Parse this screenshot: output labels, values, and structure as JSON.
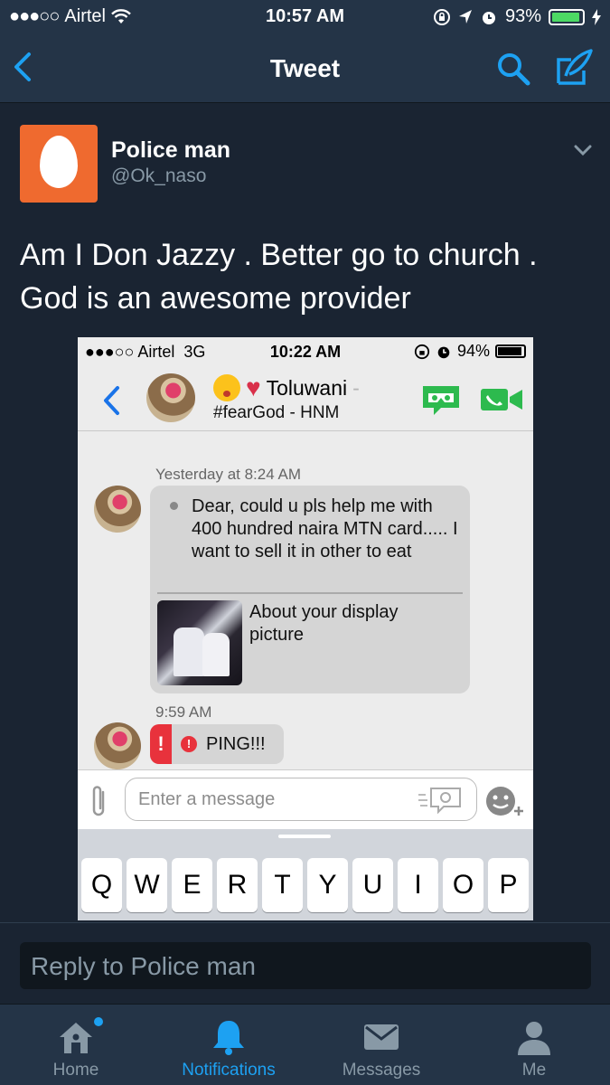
{
  "status_bar": {
    "signal": "●●●○○",
    "carrier": "Airtel",
    "time": "10:57 AM",
    "battery": "93%"
  },
  "nav": {
    "title": "Tweet"
  },
  "tweet": {
    "name": "Police man",
    "handle": "@Ok_naso",
    "text": "Am I Don Jazzy . Better go to church . God is an awesome provider"
  },
  "embedded_screenshot": {
    "status_bar": {
      "signal": "●●●○○",
      "carrier": "Airtel",
      "network": "3G",
      "time": "10:22 AM",
      "battery": "94%"
    },
    "chat_header": {
      "name": "Toluwani",
      "name_fade": "-",
      "subtitle": "#fearGod - HNM"
    },
    "messages": {
      "timestamp_1": "Yesterday at 8:24 AM",
      "message_text": "Dear, could u pls help me with 400 hundred naira MTN card..... I want to sell it in other to eat",
      "reply_caption": "About your display picture",
      "timestamp_2": "9:59 AM",
      "ping_text": "PING!!!",
      "ping_marker": "!",
      "ping_icon": "!"
    },
    "input_placeholder": "Enter a message",
    "keyboard_row": [
      "Q",
      "W",
      "E",
      "R",
      "T",
      "Y",
      "U",
      "I",
      "O",
      "P"
    ]
  },
  "reply": {
    "placeholder": "Reply to Police man"
  },
  "tabs": [
    {
      "label": "Home",
      "icon": "home-icon"
    },
    {
      "label": "Notifications",
      "icon": "bell-icon"
    },
    {
      "label": "Messages",
      "icon": "envelope-icon"
    },
    {
      "label": "Me",
      "icon": "person-icon"
    }
  ],
  "colors": {
    "accent": "#1da1f2",
    "background": "#1a2432",
    "bar": "#243447",
    "muted": "#8899a6",
    "avatar": "#ef6a2f"
  }
}
